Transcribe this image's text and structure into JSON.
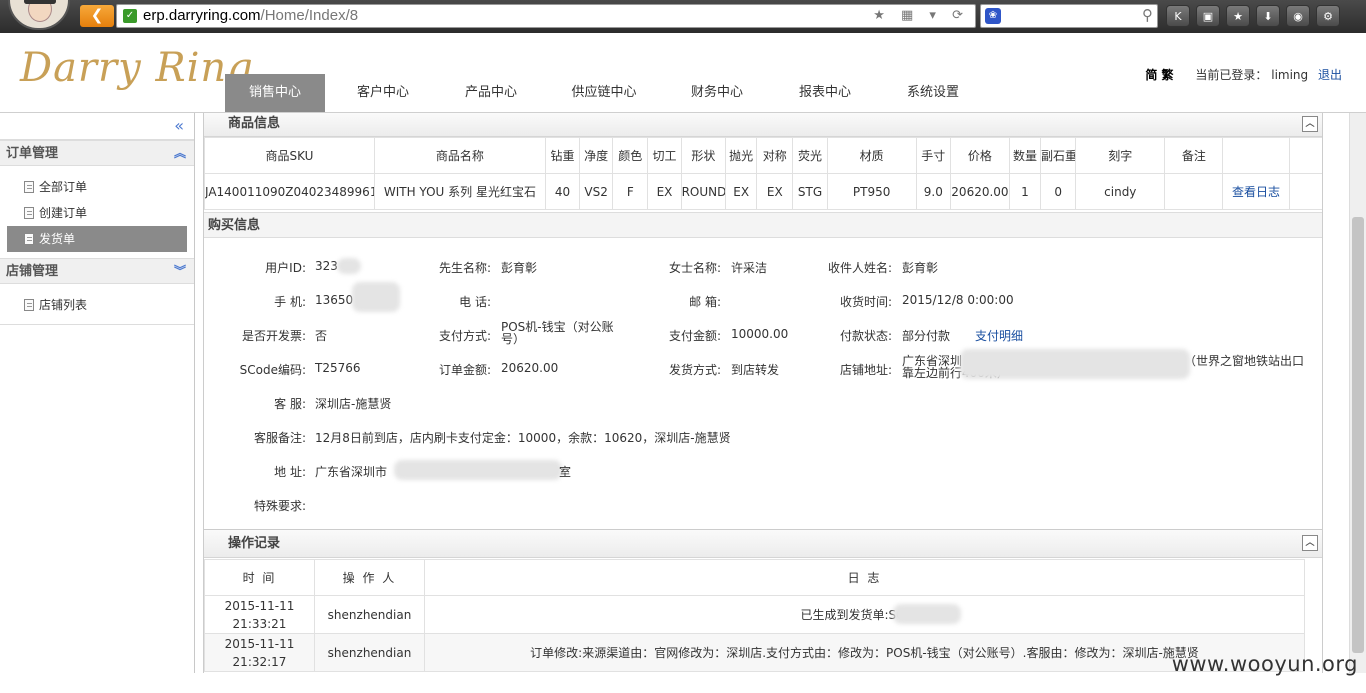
{
  "browser": {
    "url_domain": "erp.darryring.com",
    "url_path": "/Home/Index/8"
  },
  "header": {
    "logo": "Darry Ring",
    "nav": [
      {
        "label": "销售中心",
        "active": true
      },
      {
        "label": "客户中心"
      },
      {
        "label": "产品中心"
      },
      {
        "label": "供应链中心"
      },
      {
        "label": "财务中心"
      },
      {
        "label": "报表中心"
      },
      {
        "label": "系统设置"
      }
    ],
    "lang": "简 繁",
    "login_label": "当前已登录：",
    "user": "liming",
    "logout": "退出"
  },
  "sidebar": {
    "collapse_icon": "«",
    "groups": [
      {
        "title": "订单管理",
        "items": [
          "全部订单",
          "创建订单",
          "发货单"
        ]
      },
      {
        "title": "店铺管理",
        "items": [
          "店铺列表"
        ]
      }
    ]
  },
  "goods": {
    "title": "商品信息",
    "columns": [
      "商品SKU",
      "商品名称",
      "钻重",
      "净度",
      "颜色",
      "切工",
      "形状",
      "抛光",
      "对称",
      "荧光",
      "材质",
      "手寸",
      "价格",
      "数量",
      "副石重",
      "刻字",
      "备注",
      ""
    ],
    "row": [
      "JA140011090Z04023489961",
      "WITH YOU 系列 星光红宝石",
      "40",
      "VS2",
      "F",
      "EX",
      "ROUND",
      "EX",
      "EX",
      "STG",
      "PT950",
      "9.0",
      "20620.00",
      "1",
      "0",
      "cindy",
      "",
      "查看日志"
    ]
  },
  "buy": {
    "title": "购买信息",
    "user_id_label": "用户ID:",
    "user_id": "323",
    "mr_label": "先生名称:",
    "mr": "彭育彰",
    "ms_label": "女士名称:",
    "ms": "许采洁",
    "receiver_label": "收件人姓名:",
    "receiver": "彭育彰",
    "phone_label": "手 机:",
    "phone": "13650",
    "tel_label": "电 话:",
    "tel": "",
    "email_label": "邮 箱:",
    "email": "",
    "recv_time_label": "收货时间:",
    "recv_time": "2015/12/8 0:00:00",
    "invoice_label": "是否开发票:",
    "invoice": "否",
    "pay_method_label": "支付方式:",
    "pay_method": "POS机-钱宝（对公账号）",
    "pay_amount_label": "支付金额:",
    "pay_amount": "10000.00",
    "pay_status_label": "付款状态:",
    "pay_status": "部分付款",
    "pay_detail": "支付明细",
    "scode_label": "SCode编码:",
    "scode": "T25766",
    "order_amount_label": "订单金额:",
    "order_amount": "20620.00",
    "ship_label": "发货方式:",
    "ship": "到店转发",
    "shop_addr_label": "店铺地址:",
    "shop_addr_1": "广东省深圳",
    "shop_addr_2": "（世界之窗地铁站出口",
    "shop_addr_3": "靠左边前行400米）",
    "service_label": "客 服:",
    "service": "深圳店-施慧贤",
    "note_label": "客服备注:",
    "note": "12月8日前到店，店内刷卡支付定金：10000，余款：10620，深圳店-施慧贤",
    "addr_label": "地 址:",
    "addr_1": "广东省深圳市",
    "addr_2": "室",
    "special_label": "特殊要求:",
    "special": ""
  },
  "ops": {
    "title": "操作记录",
    "columns": [
      "时 间",
      "操 作 人",
      "日 志"
    ],
    "rows": [
      {
        "time1": "2015-11-11",
        "time2": "21:33:21",
        "user": "shenzhendian",
        "log": "已生成到发货单:SO201"
      },
      {
        "time1": "2015-11-11",
        "time2": "21:32:17",
        "user": "shenzhendian",
        "log": "订单修改:来源渠道由：官网修改为：深圳店.支付方式由：修改为：POS机-钱宝（对公账号）.客服由：修改为：深圳店-施慧贤"
      }
    ]
  },
  "watermark": "www.wooyun.org"
}
